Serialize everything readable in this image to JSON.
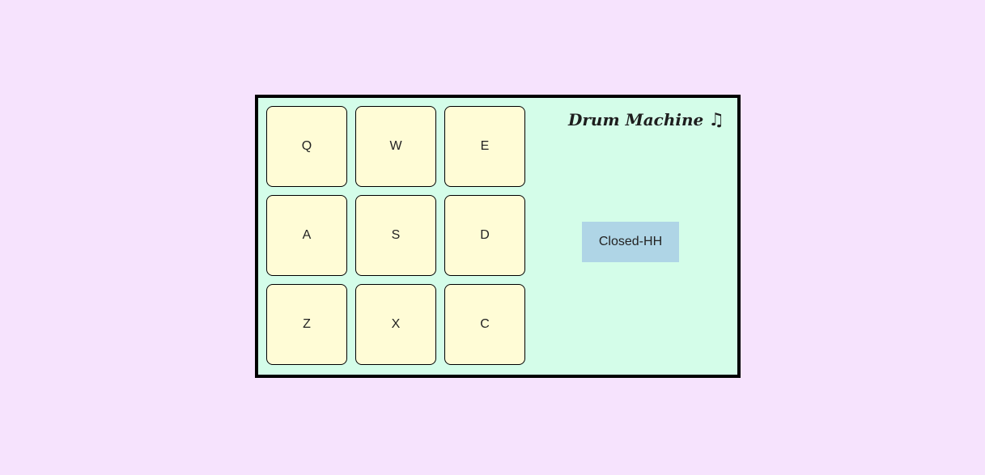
{
  "app": {
    "title": "Drum Machine",
    "title_icon": "♫",
    "colors": {
      "page_background": "#f6e3fd",
      "machine_background": "#d4fde9",
      "pad_background": "#fffcd6",
      "display_background": "#afd5e6"
    }
  },
  "pads": [
    {
      "key": "Q"
    },
    {
      "key": "W"
    },
    {
      "key": "E"
    },
    {
      "key": "A"
    },
    {
      "key": "S"
    },
    {
      "key": "D"
    },
    {
      "key": "Z"
    },
    {
      "key": "X"
    },
    {
      "key": "C"
    }
  ],
  "display": {
    "text": "Closed-HH"
  }
}
